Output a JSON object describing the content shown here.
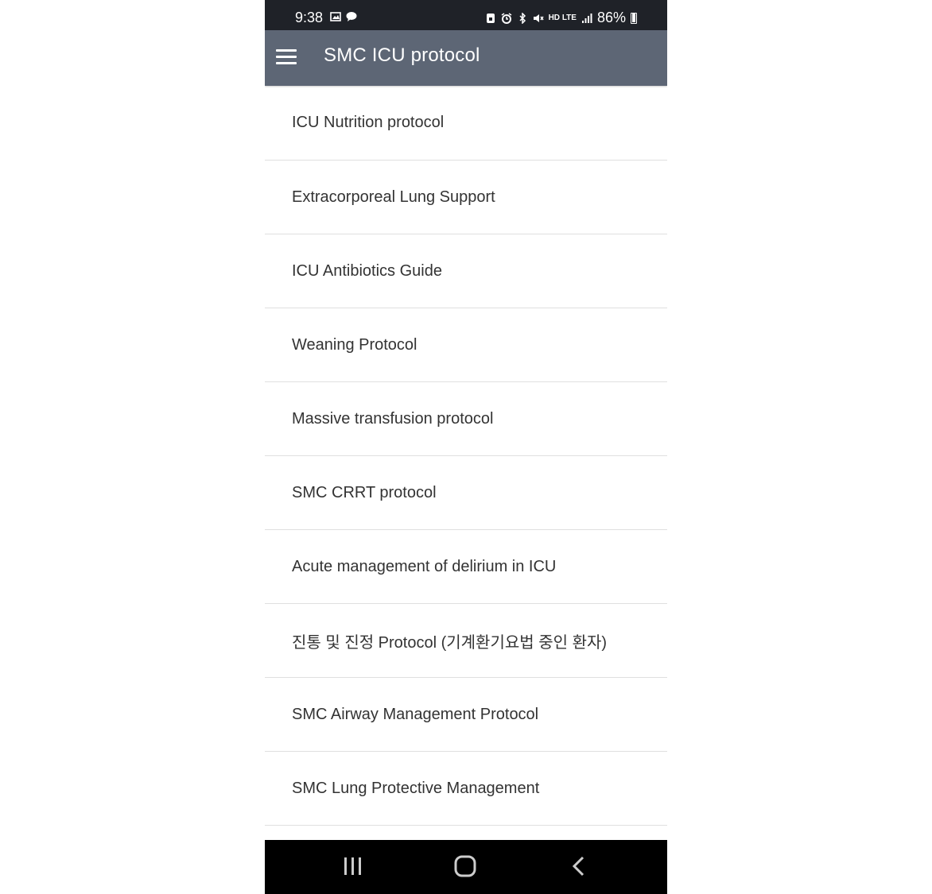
{
  "status_bar": {
    "time": "9:38",
    "battery_percent": "86%",
    "network_label_top": "HD",
    "network_label_lte": "LTE",
    "left_icons": [
      "gallery-icon",
      "talk-chat-icon"
    ],
    "right_icons": [
      "screen-lock-icon",
      "alarm-icon",
      "bluetooth-icon",
      "mute-icon",
      "signal-icon",
      "battery-icon"
    ]
  },
  "app_bar": {
    "title": "SMC ICU protocol",
    "menu_icon": "hamburger-menu-icon"
  },
  "protocols": [
    "ICU Nutrition protocol",
    "Extracorporeal Lung Support",
    "ICU Antibiotics Guide",
    "Weaning Protocol",
    "Massive transfusion protocol",
    "SMC CRRT protocol",
    "Acute management of delirium in ICU",
    "진통 및 진정 Protocol (기계환기요법 중인 환자)",
    "SMC Airway Management Protocol",
    "SMC Lung Protective Management"
  ],
  "nav_bar": {
    "icons": [
      "recent-apps-icon",
      "home-icon",
      "back-icon"
    ]
  },
  "colors": {
    "status_bar_bg": "#1f2228",
    "app_bar_bg": "#5d6675",
    "text": "#333333",
    "divider": "#e0e0e0",
    "nav_bar_bg": "#000000"
  }
}
